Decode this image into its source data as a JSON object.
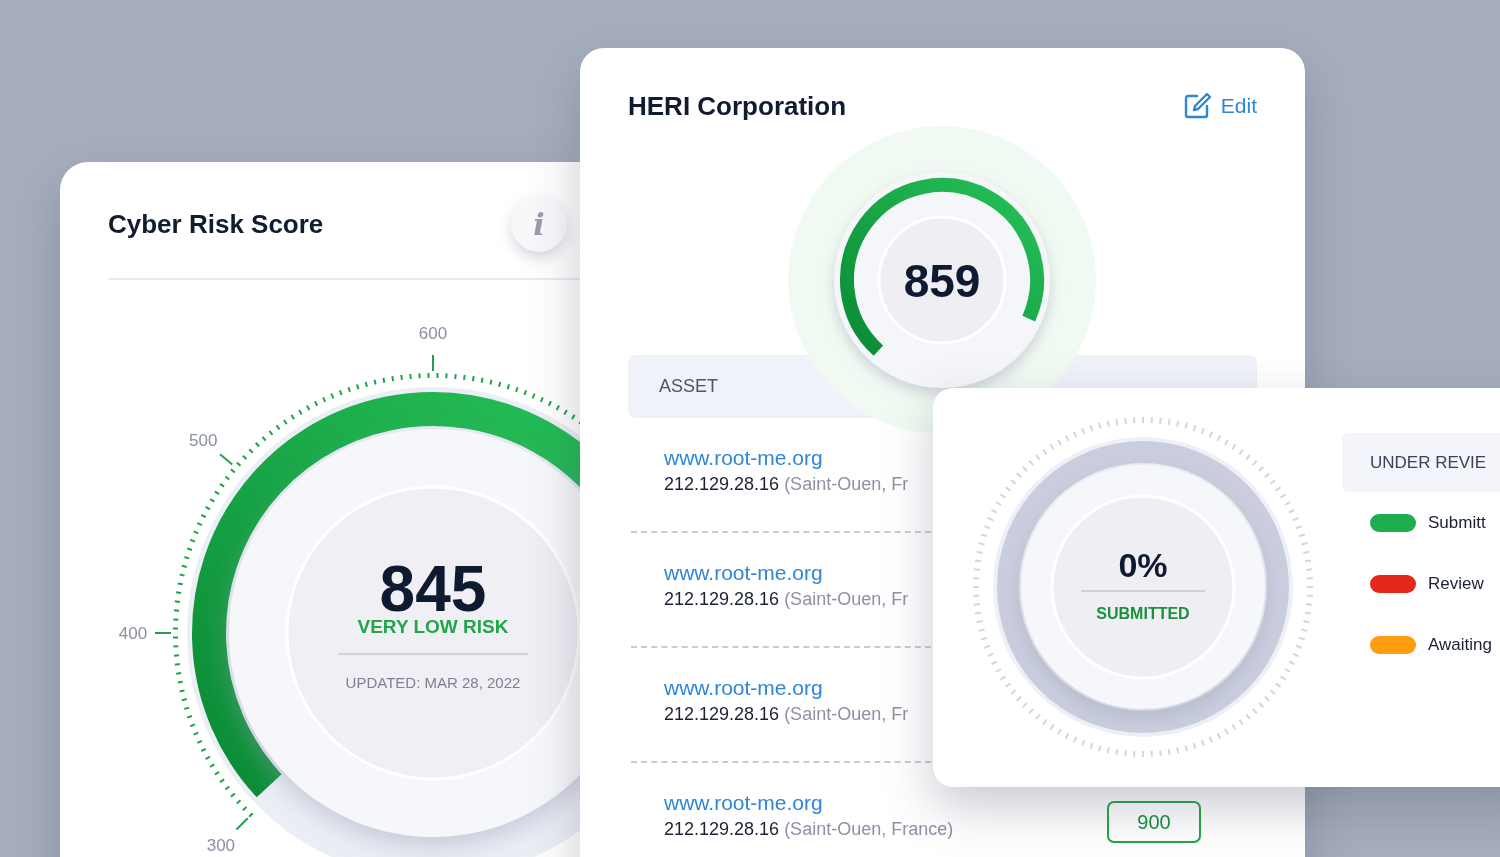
{
  "risk_card": {
    "title": "Cyber Risk Score",
    "info_icon": "i",
    "gauge": {
      "scale": [
        "300",
        "400",
        "500",
        "600"
      ],
      "score": "845",
      "rating": "VERY LOW RISK",
      "updated": "UPDATED: MAR 28, 2022"
    }
  },
  "company_card": {
    "title": "HERI Corporation",
    "edit_label": "Edit",
    "gauge": {
      "score": "859"
    },
    "table": {
      "columns": [
        "ASSET"
      ],
      "rows": [
        {
          "domain": "www.root-me.org",
          "ip": "212.129.28.16",
          "location": "(Saint-Ouen, Fr"
        },
        {
          "domain": "www.root-me.org",
          "ip": "212.129.28.16",
          "location": "(Saint-Ouen, Fr"
        },
        {
          "domain": "www.root-me.org",
          "ip": "212.129.28.16",
          "location": "(Saint-Ouen, Fr"
        },
        {
          "domain": "www.root-me.org",
          "ip": "212.129.28.16",
          "location": "(Saint-Ouen, France)",
          "score": "900"
        }
      ]
    }
  },
  "review_card": {
    "donut": {
      "value": "0%",
      "label": "SUBMITTED"
    },
    "legend_header": "UNDER REVIE",
    "legend": [
      {
        "label": "Submitt",
        "color": "#1fae4f"
      },
      {
        "label": "Review",
        "color": "#e5281c"
      },
      {
        "label": "Awaiting",
        "color": "#ff9c0f"
      }
    ]
  }
}
